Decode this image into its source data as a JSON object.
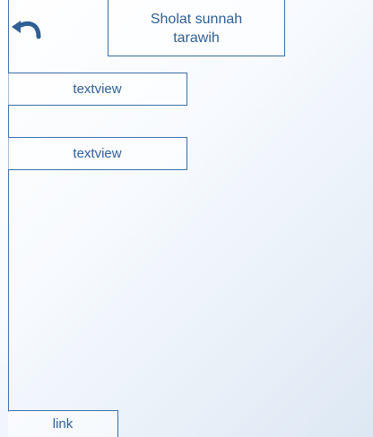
{
  "header": {
    "back_icon": "back-arrow-icon",
    "title": "Sholat sunnah\ntarawih"
  },
  "content": {
    "textview_1": "textview",
    "textview_2": "textview"
  },
  "footer": {
    "link_label": "link"
  },
  "colors": {
    "border": "#3d6fa6",
    "text": "#2f5f95",
    "background_gradient": [
      "#ffffff",
      "#dde8f4"
    ]
  }
}
